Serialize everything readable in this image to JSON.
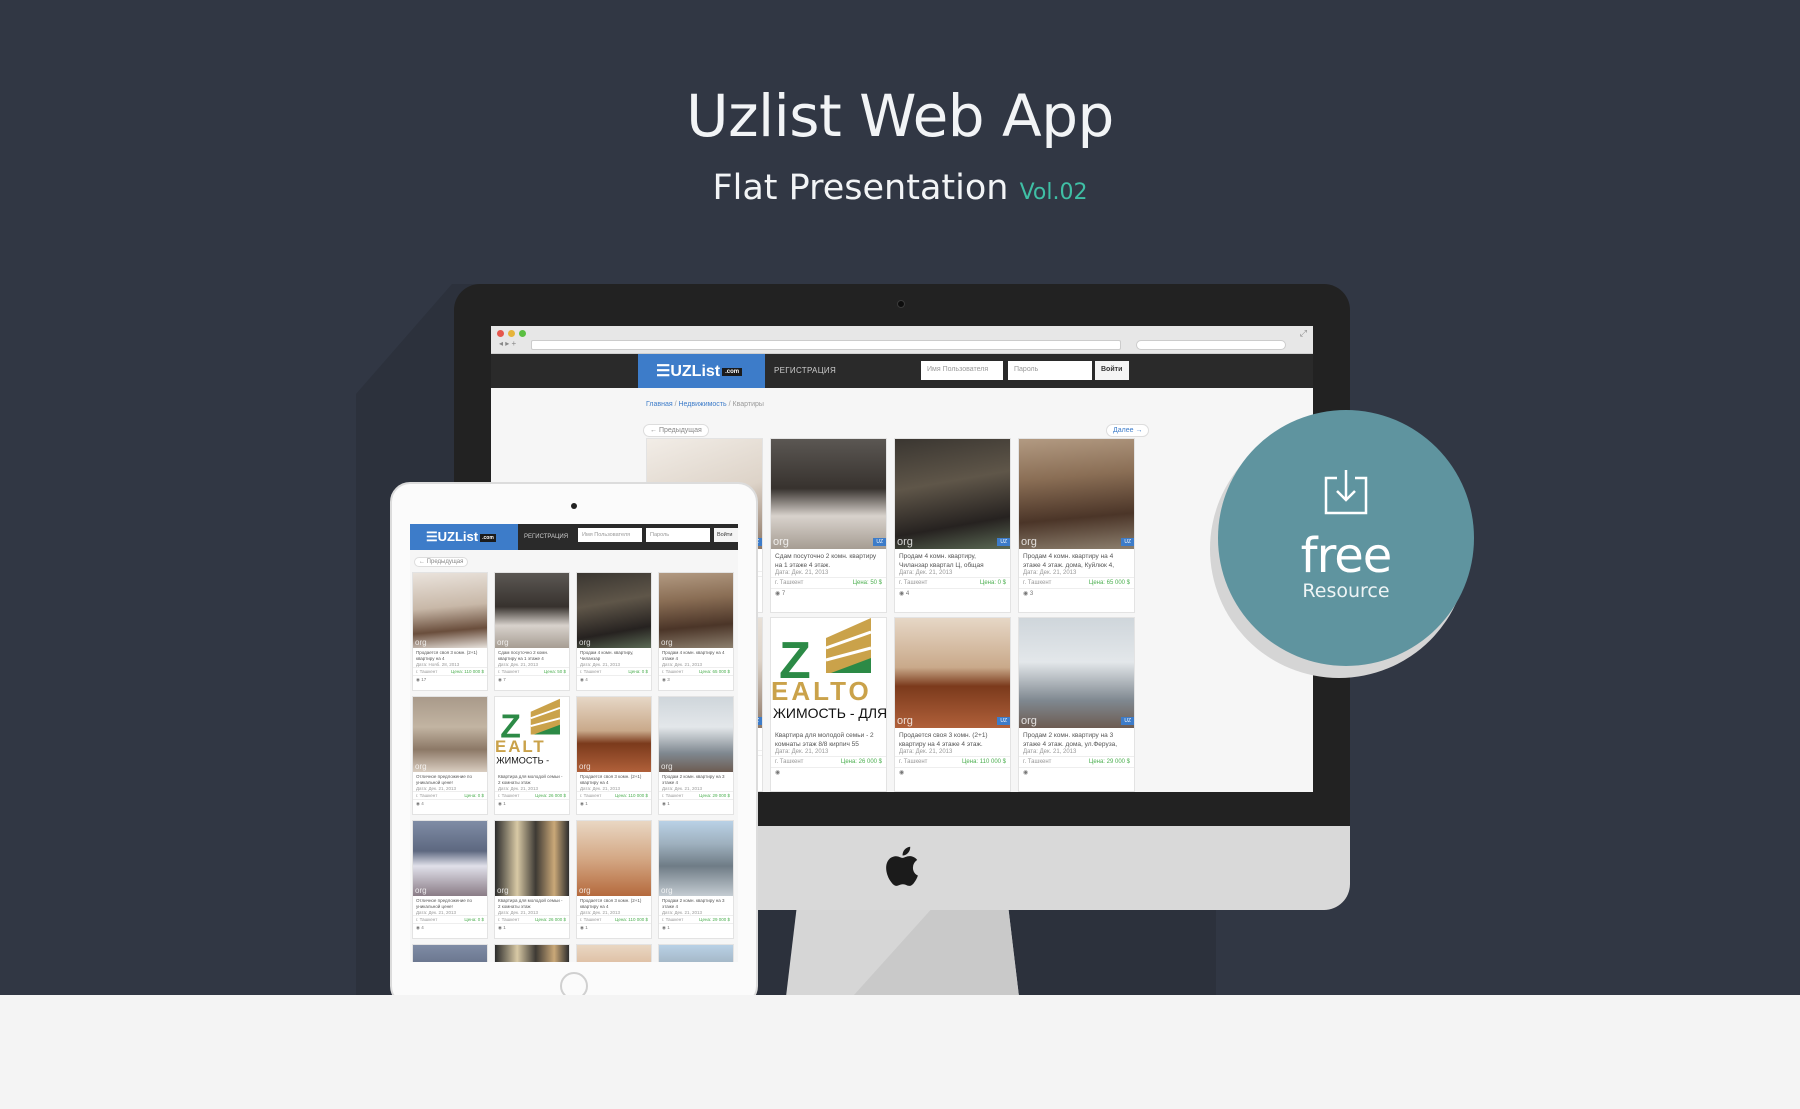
{
  "header": {
    "title": "Uzlist Web App",
    "subtitle": "Flat Presentation",
    "vol": "Vol.02"
  },
  "badge": {
    "icon": "download-icon",
    "free": "free",
    "resource": "Resource"
  },
  "site": {
    "logo": "UZList",
    "logo_com": ".com",
    "register": "РЕГИСТРАЦИЯ",
    "username_placeholder": "Имя Пользователя",
    "password_placeholder": "Пароль",
    "login": "Войти",
    "breadcrumb": [
      "Главная",
      "Недвижимость",
      "Квартиры"
    ],
    "prev": "← Предыдущая",
    "next": "Далее →"
  },
  "desktop_listings": [
    {
      "desc": "",
      "date": "",
      "city": "",
      "price": "",
      "views": "",
      "photo": "room1"
    },
    {
      "desc": "Сдам посуточно 2 комн. квартиру на 1 этаже 4 этаж.",
      "date": "Дата: Дек. 21, 2013",
      "city": "г. Ташкент",
      "price": "Цена: 50 $",
      "views": "7",
      "photo": "room2"
    },
    {
      "desc": "Продам 4 комн. квартиру, Чиланзар квартал Ц, общая",
      "date": "Дата: Дек. 21, 2013",
      "city": "г. Ташкент",
      "price": "Цена: 0 $",
      "views": "4",
      "photo": "room3"
    },
    {
      "desc": "Продам 4 комн. квартиру на 4 этаже 4 этаж. дома, Куйлюк 4,",
      "date": "Дата: Дек. 21, 2013",
      "city": "г. Ташкент",
      "price": "Цена: 65 000 $",
      "views": "3",
      "photo": "room4"
    },
    {
      "desc": "",
      "date": "",
      "city": "",
      "price": "",
      "views": "",
      "photo": "room1"
    },
    {
      "desc": "Квартира для молодой семьи - 2 комнаты этаж 8/8 кирпич 55",
      "date": "Дата: Дек. 21, 2013",
      "city": "г. Ташкент",
      "price": "Цена: 26 000 $",
      "views": "",
      "photo": "logo"
    },
    {
      "desc": "Продается своя 3 комн. (2+1) квартиру на 4 этаже 4 этаж.",
      "date": "Дата: Дек. 21, 2013",
      "city": "г. Ташкент",
      "price": "Цена: 110 000 $",
      "views": "",
      "photo": "floor"
    },
    {
      "desc": "Продам 2 комн. квартиру на 3 этаже 4 этаж. дома, ул.Феруза,",
      "date": "Дата: Дек. 21, 2013",
      "city": "г. Ташкент",
      "price": "Цена: 29 000 $",
      "views": "",
      "photo": "lobby"
    }
  ],
  "ipad_listings": [
    {
      "desc": "Продается своя 3 комн. (2+1) квартиру на 4",
      "date": "Дата: Нояб. 28, 2013",
      "city": "г. Ташкент",
      "price": "Цена: 110 000 $",
      "views": "17",
      "photo": "bed"
    },
    {
      "desc": "Сдам посуточно 2 комн. квартиру на 1 этаже 4",
      "date": "Дата: Дек. 21, 2013",
      "city": "г. Ташкент",
      "price": "Цена: 50 $",
      "views": "7",
      "photo": "room2"
    },
    {
      "desc": "Продам 4 комн. квартиру, Чиланзар",
      "date": "Дата: Дек. 21, 2013",
      "city": "г. Ташкент",
      "price": "Цена: 0 $",
      "views": "4",
      "photo": "room3"
    },
    {
      "desc": "Продам 4 комн. квартиру на 4 этаже 4",
      "date": "Дата: Дек. 21, 2013",
      "city": "г. Ташкент",
      "price": "Цена: 65 000 $",
      "views": "3",
      "photo": "room4"
    },
    {
      "desc": "Отличное предложение по уникальной цене!",
      "date": "Дата: Дек. 21, 2013",
      "city": "г. Ташкент",
      "price": "Цена: 0 $",
      "views": "4",
      "photo": "sofa"
    },
    {
      "desc": "Квартира для молодой семьи - 2 комнаты этаж",
      "date": "Дата: Дек. 21, 2013",
      "city": "г. Ташкент",
      "price": "Цена: 26 000 $",
      "views": "1",
      "photo": "logo"
    },
    {
      "desc": "Продается своя 3 комн. (2+1) квартиру на 4",
      "date": "Дата: Дек. 21, 2013",
      "city": "г. Ташкент",
      "price": "Цена: 110 000 $",
      "views": "1",
      "photo": "floor"
    },
    {
      "desc": "Продам 2 комн. квартиру на 3 этаже 4",
      "date": "Дата: Дек. 21, 2013",
      "city": "г. Ташкент",
      "price": "Цена: 29 000 $",
      "views": "1",
      "photo": "lobby"
    },
    {
      "desc": "Отличное предложение по уникальной цене!",
      "date": "Дата: Дек. 21, 2013",
      "city": "г. Ташкент",
      "price": "Цена: 0 $",
      "views": "4",
      "photo": "darkroom"
    },
    {
      "desc": "Квартира для молодой семьи - 2 комнаты этаж",
      "date": "Дата: Дек. 21, 2013",
      "city": "г. Ташкент",
      "price": "Цена: 26 000 $",
      "views": "1",
      "photo": "towers"
    },
    {
      "desc": "Продается своя 3 комн. (2+1) квартиру на 4",
      "date": "Дата: Дек. 21, 2013",
      "city": "г. Ташкент",
      "price": "Цена: 110 000 $",
      "views": "1",
      "photo": "hall"
    },
    {
      "desc": "Продам 2 комн. квартиру на 3 этаже 4",
      "date": "Дата: Дек. 21, 2013",
      "city": "г. Ташкент",
      "price": "Цена: 29 000 $",
      "views": "1",
      "photo": "building"
    },
    {
      "desc": "",
      "date": "",
      "city": "",
      "price": "",
      "views": "",
      "photo": "darkroom"
    },
    {
      "desc": "",
      "date": "",
      "city": "",
      "price": "",
      "views": "",
      "photo": "towers"
    },
    {
      "desc": "",
      "date": "",
      "city": "",
      "price": "",
      "views": "",
      "photo": "hall"
    },
    {
      "desc": "",
      "date": "",
      "city": "",
      "price": "",
      "views": "",
      "photo": "building"
    }
  ],
  "watermarks": {
    "org": "org",
    "tag": "UZ"
  },
  "logo_text": {
    "z": "Z",
    "ealtor": "EALTO",
    "ipad_ealtor": "EALT",
    "tagline": "ЖИМОСТЬ - ДЛЯ",
    "ipad_tagline": "ЖИМОСТЬ -"
  }
}
